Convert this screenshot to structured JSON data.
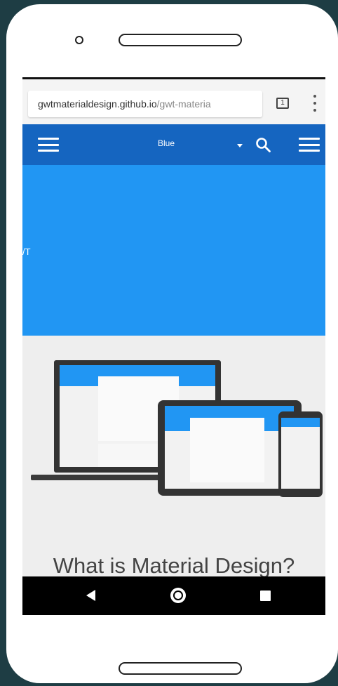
{
  "browser": {
    "url_host": "gwtmaterialdesign.github.io",
    "url_path": "/gwt-materia",
    "tab_count": "1",
    "menu_icon": "overflow-dots-icon"
  },
  "app_bar": {
    "color": "#1565c0",
    "theme_label": "Blue",
    "left_icon": "hamburger-icon",
    "search_icon": "search-icon",
    "right_icon": "hamburger-icon"
  },
  "hero": {
    "color": "#2196f3",
    "partial_text": "/T"
  },
  "content": {
    "illustration": "devices-illustration",
    "heading": "What is Material Design?"
  },
  "system_nav": {
    "back_icon": "back-triangle-icon",
    "home_icon": "home-circle-icon",
    "recents_icon": "recents-square-icon"
  }
}
